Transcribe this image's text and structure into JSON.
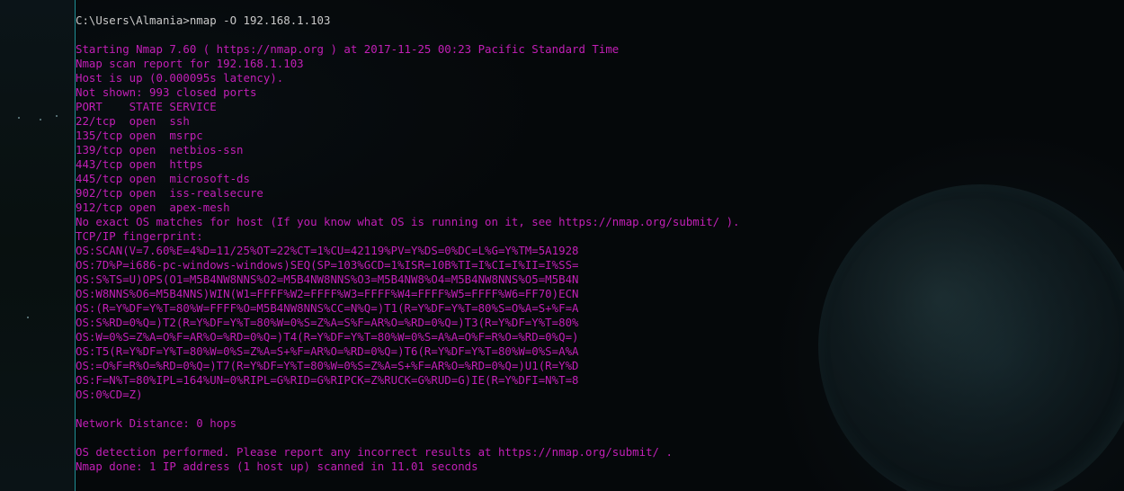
{
  "terminal": {
    "prompt_line": "C:\\Users\\Almania>nmap -O 192.168.1.103",
    "output_lines": [
      "",
      "Starting Nmap 7.60 ( https://nmap.org ) at 2017-11-25 00:23 Pacific Standard Time",
      "Nmap scan report for 192.168.1.103",
      "Host is up (0.000095s latency).",
      "Not shown: 993 closed ports",
      "PORT    STATE SERVICE",
      "22/tcp  open  ssh",
      "135/tcp open  msrpc",
      "139/tcp open  netbios-ssn",
      "443/tcp open  https",
      "445/tcp open  microsoft-ds",
      "902/tcp open  iss-realsecure",
      "912/tcp open  apex-mesh",
      "No exact OS matches for host (If you know what OS is running on it, see https://nmap.org/submit/ ).",
      "TCP/IP fingerprint:",
      "OS:SCAN(V=7.60%E=4%D=11/25%OT=22%CT=1%CU=42119%PV=Y%DS=0%DC=L%G=Y%TM=5A1928",
      "OS:7D%P=i686-pc-windows-windows)SEQ(SP=103%GCD=1%ISR=10B%TI=I%CI=I%II=I%SS=",
      "OS:S%TS=U)OPS(O1=M5B4NW8NNS%O2=M5B4NW8NNS%O3=M5B4NW8%O4=M5B4NW8NNS%O5=M5B4N",
      "OS:W8NNS%O6=M5B4NNS)WIN(W1=FFFF%W2=FFFF%W3=FFFF%W4=FFFF%W5=FFFF%W6=FF70)ECN",
      "OS:(R=Y%DF=Y%T=80%W=FFFF%O=M5B4NW8NNS%CC=N%Q=)T1(R=Y%DF=Y%T=80%S=O%A=S+%F=A",
      "OS:S%RD=0%Q=)T2(R=Y%DF=Y%T=80%W=0%S=Z%A=S%F=AR%O=%RD=0%Q=)T3(R=Y%DF=Y%T=80%",
      "OS:W=0%S=Z%A=O%F=AR%O=%RD=0%Q=)T4(R=Y%DF=Y%T=80%W=0%S=A%A=O%F=R%O=%RD=0%Q=)",
      "OS:T5(R=Y%DF=Y%T=80%W=0%S=Z%A=S+%F=AR%O=%RD=0%Q=)T6(R=Y%DF=Y%T=80%W=0%S=A%A",
      "OS:=O%F=R%O=%RD=0%Q=)T7(R=Y%DF=Y%T=80%W=0%S=Z%A=S+%F=AR%O=%RD=0%Q=)U1(R=Y%D",
      "OS:F=N%T=80%IPL=164%UN=0%RIPL=G%RID=G%RIPCK=Z%RUCK=G%RUD=G)IE(R=Y%DFI=N%T=8",
      "OS:0%CD=Z)",
      "",
      "Network Distance: 0 hops",
      "",
      "OS detection performed. Please report any incorrect results at https://nmap.org/submit/ .",
      "Nmap done: 1 IP address (1 host up) scanned in 11.01 seconds"
    ]
  },
  "colors": {
    "prompt_text": "#c9c9c9",
    "output_text": "#c21fb6",
    "background": "#05080a",
    "divider": "#1f8f95"
  }
}
